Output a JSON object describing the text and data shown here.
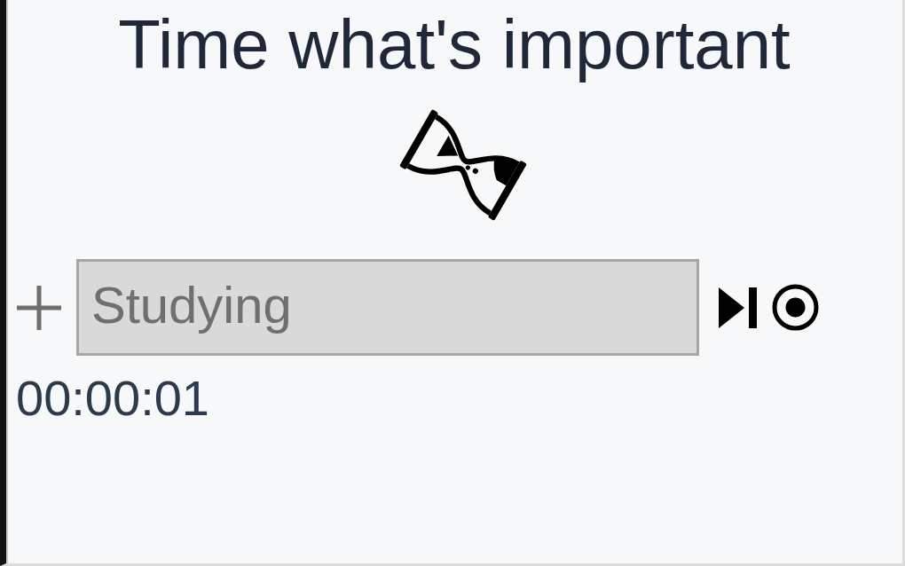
{
  "title": "Time what's important",
  "task": {
    "value": "Studying",
    "disabled": true
  },
  "elapsed": "00:00:01"
}
